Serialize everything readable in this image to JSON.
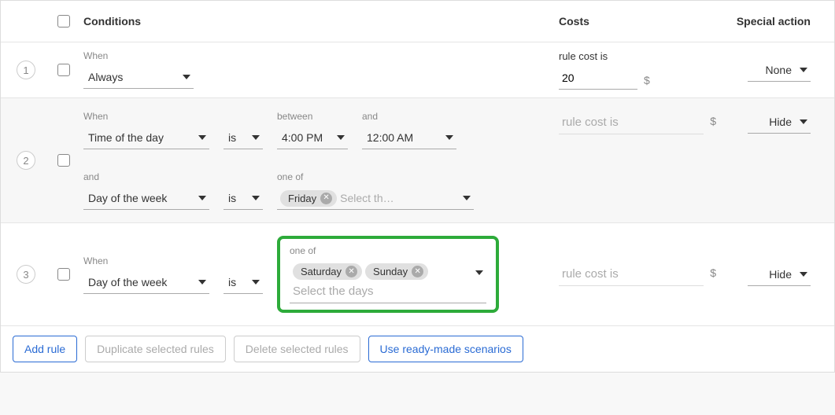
{
  "headers": {
    "conditions": "Conditions",
    "costs": "Costs",
    "special_action": "Special action"
  },
  "labels": {
    "when": "When",
    "and": "and",
    "between": "between",
    "one_of": "one of",
    "is": "is",
    "rule_cost_is": "rule cost is",
    "currency": "$",
    "select_days_placeholder_short": "Select th…",
    "select_days_placeholder": "Select the days"
  },
  "actions": {
    "none": "None",
    "hide": "Hide"
  },
  "rules": [
    {
      "num": "1",
      "condition_type": "Always",
      "cost_value": "20",
      "action": "None"
    },
    {
      "num": "2",
      "line1": {
        "type": "Time of the day",
        "between": "4:00 PM",
        "and": "12:00 AM"
      },
      "line2": {
        "type": "Day of the week",
        "chips": [
          "Friday"
        ]
      },
      "action": "Hide"
    },
    {
      "num": "3",
      "type": "Day of the week",
      "chips": [
        "Saturday",
        "Sunday"
      ],
      "action": "Hide"
    }
  ],
  "footer": {
    "add_rule": "Add rule",
    "duplicate": "Duplicate selected rules",
    "delete": "Delete selected rules",
    "scenarios": "Use ready-made scenarios"
  }
}
